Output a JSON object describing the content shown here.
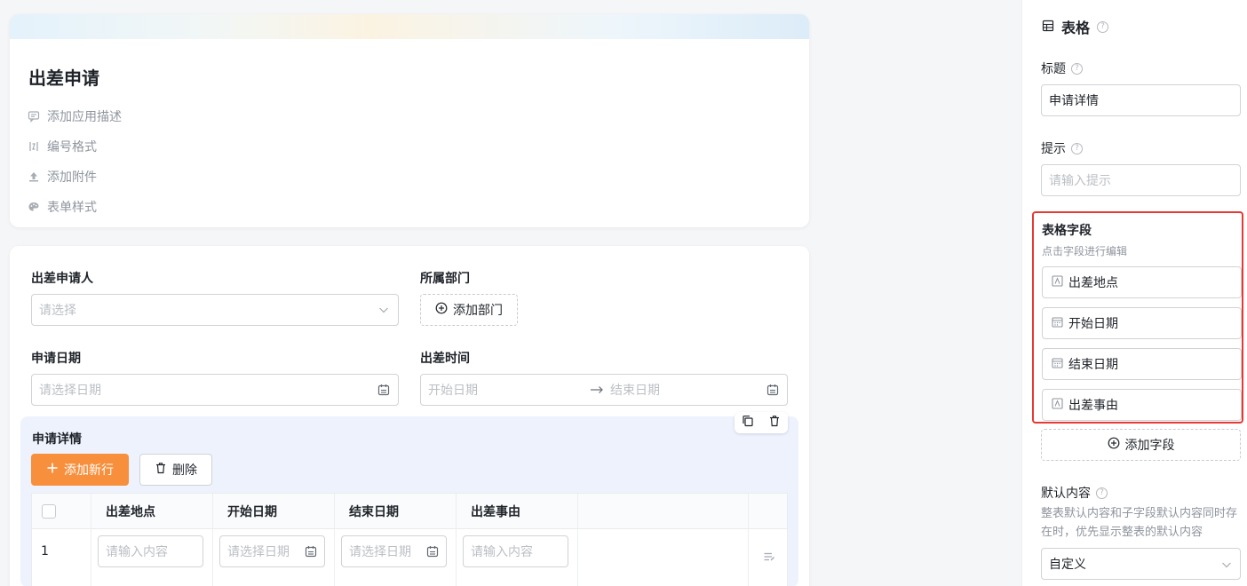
{
  "header": {
    "title": "出差申请",
    "actions": [
      {
        "label": "添加应用描述",
        "icon": "comment-icon"
      },
      {
        "label": "编号格式",
        "icon": "number-format-icon"
      },
      {
        "label": "添加附件",
        "icon": "upload-icon"
      },
      {
        "label": "表单样式",
        "icon": "palette-icon"
      }
    ]
  },
  "form": {
    "applicant": {
      "label": "出差申请人",
      "placeholder": "请选择"
    },
    "department": {
      "label": "所属部门",
      "button": "添加部门"
    },
    "apply_date": {
      "label": "申请日期",
      "placeholder": "请选择日期"
    },
    "trip_time": {
      "label": "出差时间",
      "start_placeholder": "开始日期",
      "end_placeholder": "结束日期"
    }
  },
  "subtable": {
    "title": "申请详情",
    "add_row_button": "添加新行",
    "delete_button": "删除",
    "columns": [
      "出差地点",
      "开始日期",
      "结束日期",
      "出差事由"
    ],
    "rows": [
      {
        "index": "1",
        "cells": [
          "请输入内容",
          "请选择日期",
          "请选择日期",
          "请输入内容"
        ]
      }
    ]
  },
  "panel": {
    "title": "表格",
    "title_label": "标题",
    "title_value": "申请详情",
    "hint_label": "提示",
    "hint_placeholder": "请输入提示",
    "fields_title": "表格字段",
    "fields_subtitle": "点击字段进行编辑",
    "fields": [
      {
        "label": "出差地点",
        "icon": "text-field-icon"
      },
      {
        "label": "开始日期",
        "icon": "calendar-icon"
      },
      {
        "label": "结束日期",
        "icon": "calendar-icon"
      },
      {
        "label": "出差事由",
        "icon": "text-field-icon"
      }
    ],
    "add_field_button": "添加字段",
    "default_label": "默认内容",
    "default_desc": "整表默认内容和子字段默认内容同时存在时，优先显示整表的默认内容",
    "default_value": "自定义"
  },
  "colors": {
    "primary_orange": "#f78f3c",
    "highlight_red": "#e53935",
    "subtable_bg": "#eef2fd"
  }
}
